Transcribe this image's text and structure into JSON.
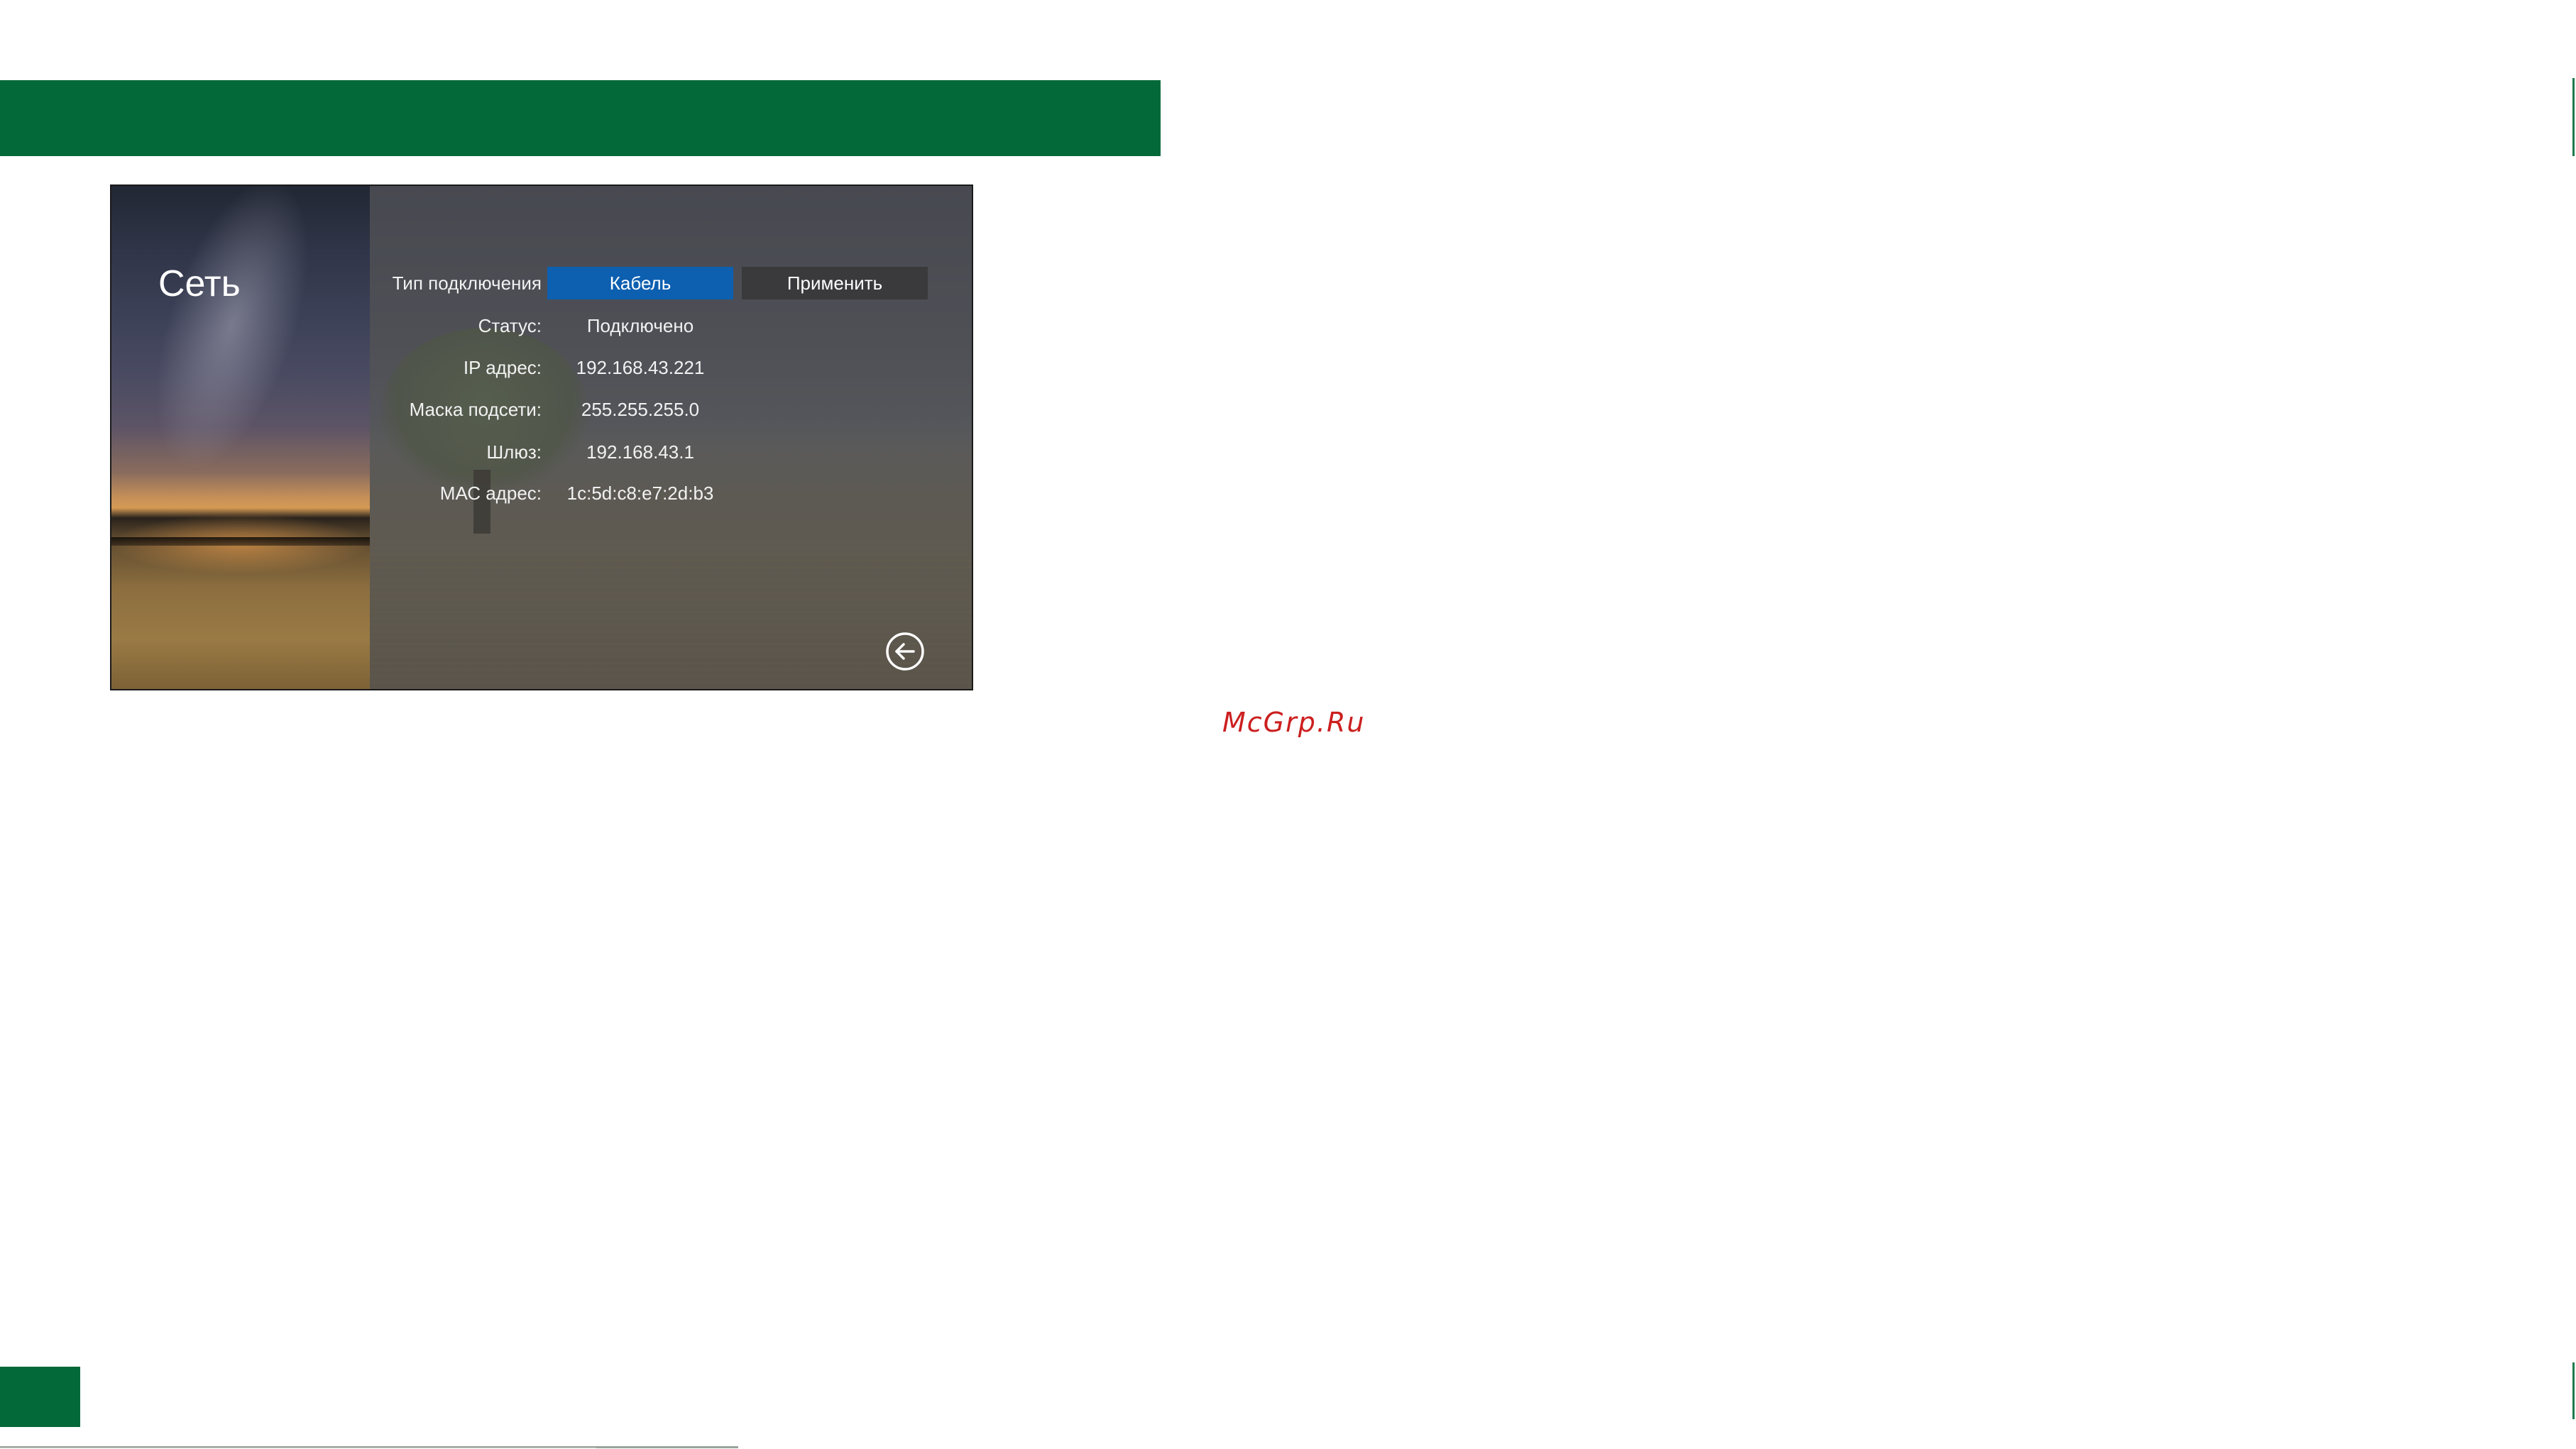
{
  "page": {
    "watermark": "McGrp.Ru",
    "colors": {
      "brand_green": "#036938",
      "accent_blue": "#0d5fb0",
      "button_dark": "#3a3a3c",
      "watermark_red": "#cc1f1f"
    }
  },
  "screen": {
    "title": "Сеть",
    "connection": {
      "label": "Тип подключения",
      "type_button": "Кабель",
      "apply_button": "Применить"
    },
    "rows": [
      {
        "label": "Статус:",
        "value": "Подключено"
      },
      {
        "label": "IP адрес:",
        "value": "192.168.43.221"
      },
      {
        "label": "Маска подсети:",
        "value": "255.255.255.0"
      },
      {
        "label": "Шлюз:",
        "value": "192.168.43.1"
      },
      {
        "label": "МАС адрес:",
        "value": "1c:5d:c8:e7:2d:b3"
      }
    ],
    "back_icon": "back-arrow-circle-icon"
  }
}
